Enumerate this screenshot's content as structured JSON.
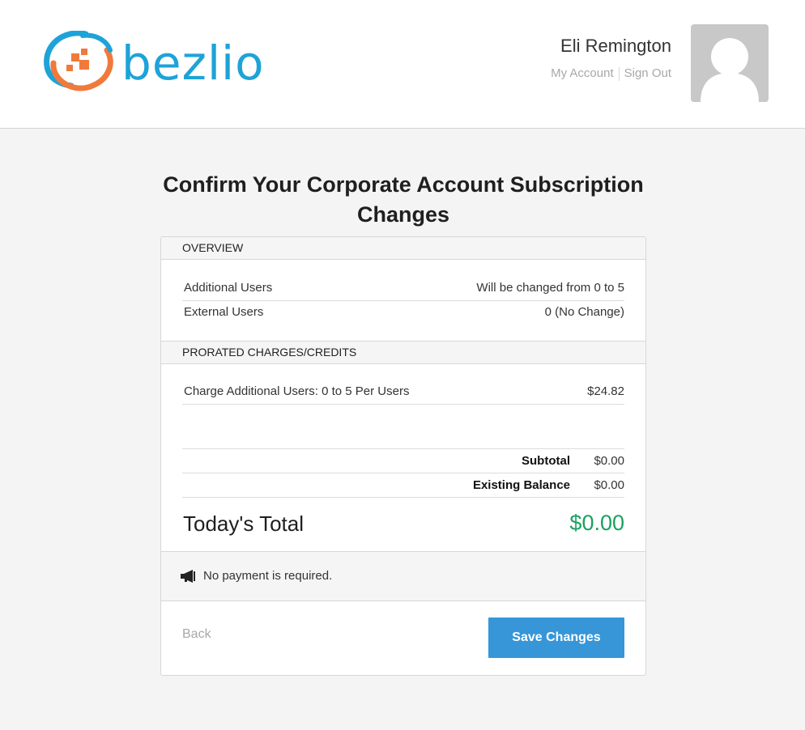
{
  "brand": {
    "name": "bezlio"
  },
  "user": {
    "name": "Eli Remington",
    "my_account": "My Account",
    "sign_out": "Sign Out"
  },
  "page": {
    "title": "Confirm Your Corporate Account Subscription Changes"
  },
  "overview": {
    "heading": "OVERVIEW",
    "rows": [
      {
        "label": "Additional Users",
        "value": "Will be changed from 0 to 5"
      },
      {
        "label": "External Users",
        "value": "0 (No Change)"
      }
    ]
  },
  "prorated": {
    "heading": "PRORATED CHARGES/CREDITS",
    "rows": [
      {
        "label": "Charge Additional Users: 0 to 5 Per Users",
        "value": "$24.82"
      }
    ]
  },
  "summary": {
    "subtotal_label": "Subtotal",
    "subtotal_value": "$0.00",
    "balance_label": "Existing Balance",
    "balance_value": "$0.00",
    "total_label": "Today's Total",
    "total_value": "$0.00"
  },
  "notice": {
    "icon": "megaphone-icon",
    "text": "No payment is required."
  },
  "actions": {
    "back_label": "Back",
    "save_label": "Save Changes"
  },
  "colors": {
    "brand_blue": "#1ea3d8",
    "brand_orange": "#f07a3c",
    "accent_button": "#3696d8",
    "total_green": "#1aa260"
  }
}
